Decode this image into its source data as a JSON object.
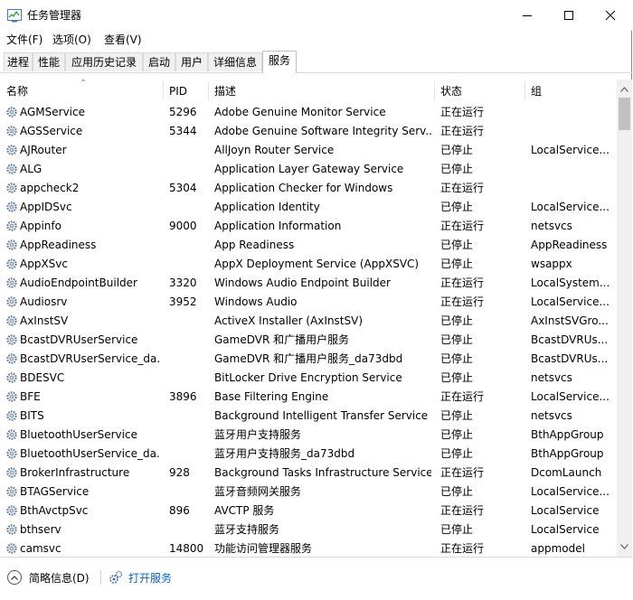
{
  "window": {
    "title": "任务管理器"
  },
  "menu": {
    "file": "文件(F)",
    "options": "选项(O)",
    "view": "查看(V)"
  },
  "tabs": [
    "进程",
    "性能",
    "应用历史记录",
    "启动",
    "用户",
    "详细信息",
    "服务"
  ],
  "columns": {
    "name": "名称",
    "pid": "PID",
    "desc": "描述",
    "status": "状态",
    "group": "组"
  },
  "rows": [
    {
      "name": "AGMService",
      "pid": "5296",
      "desc": "Adobe Genuine Monitor Service",
      "status": "正在运行",
      "group": ""
    },
    {
      "name": "AGSService",
      "pid": "5344",
      "desc": "Adobe Genuine Software Integrity Serv...",
      "status": "正在运行",
      "group": ""
    },
    {
      "name": "AJRouter",
      "pid": "",
      "desc": "AllJoyn Router Service",
      "status": "已停止",
      "group": "LocalService..."
    },
    {
      "name": "ALG",
      "pid": "",
      "desc": "Application Layer Gateway Service",
      "status": "已停止",
      "group": ""
    },
    {
      "name": "appcheck2",
      "pid": "5304",
      "desc": "Application Checker for Windows",
      "status": "正在运行",
      "group": ""
    },
    {
      "name": "AppIDSvc",
      "pid": "",
      "desc": "Application Identity",
      "status": "已停止",
      "group": "LocalService..."
    },
    {
      "name": "Appinfo",
      "pid": "9000",
      "desc": "Application Information",
      "status": "正在运行",
      "group": "netsvcs"
    },
    {
      "name": "AppReadiness",
      "pid": "",
      "desc": "App Readiness",
      "status": "已停止",
      "group": "AppReadiness"
    },
    {
      "name": "AppXSvc",
      "pid": "",
      "desc": "AppX Deployment Service (AppXSVC)",
      "status": "已停止",
      "group": "wsappx"
    },
    {
      "name": "AudioEndpointBuilder",
      "pid": "3320",
      "desc": "Windows Audio Endpoint Builder",
      "status": "正在运行",
      "group": "LocalSystem..."
    },
    {
      "name": "Audiosrv",
      "pid": "3952",
      "desc": "Windows Audio",
      "status": "正在运行",
      "group": "LocalService..."
    },
    {
      "name": "AxInstSV",
      "pid": "",
      "desc": "ActiveX Installer (AxInstSV)",
      "status": "已停止",
      "group": "AxInstSVGro..."
    },
    {
      "name": "BcastDVRUserService",
      "pid": "",
      "desc": "GameDVR 和广播用户服务",
      "status": "已停止",
      "group": "BcastDVRUs..."
    },
    {
      "name": "BcastDVRUserService_da...",
      "pid": "",
      "desc": "GameDVR 和广播用户服务_da73dbd",
      "status": "已停止",
      "group": "BcastDVRUs..."
    },
    {
      "name": "BDESVC",
      "pid": "",
      "desc": "BitLocker Drive Encryption Service",
      "status": "已停止",
      "group": "netsvcs"
    },
    {
      "name": "BFE",
      "pid": "3896",
      "desc": "Base Filtering Engine",
      "status": "正在运行",
      "group": "LocalService..."
    },
    {
      "name": "BITS",
      "pid": "",
      "desc": "Background Intelligent Transfer Service",
      "status": "已停止",
      "group": "netsvcs"
    },
    {
      "name": "BluetoothUserService",
      "pid": "",
      "desc": "蓝牙用户支持服务",
      "status": "已停止",
      "group": "BthAppGroup"
    },
    {
      "name": "BluetoothUserService_da...",
      "pid": "",
      "desc": "蓝牙用户支持服务_da73dbd",
      "status": "已停止",
      "group": "BthAppGroup"
    },
    {
      "name": "BrokerInfrastructure",
      "pid": "928",
      "desc": "Background Tasks Infrastructure Service",
      "status": "正在运行",
      "group": "DcomLaunch"
    },
    {
      "name": "BTAGService",
      "pid": "",
      "desc": "蓝牙音频网关服务",
      "status": "已停止",
      "group": "LocalService..."
    },
    {
      "name": "BthAvctpSvc",
      "pid": "896",
      "desc": "AVCTP 服务",
      "status": "正在运行",
      "group": "LocalService"
    },
    {
      "name": "bthserv",
      "pid": "",
      "desc": "蓝牙支持服务",
      "status": "已停止",
      "group": "LocalService"
    },
    {
      "name": "camsvc",
      "pid": "14800",
      "desc": "功能访问管理器服务",
      "status": "正在运行",
      "group": "appmodel"
    }
  ],
  "footer": {
    "fewer_details": "简略信息(D)",
    "open_services": "打开服务"
  }
}
